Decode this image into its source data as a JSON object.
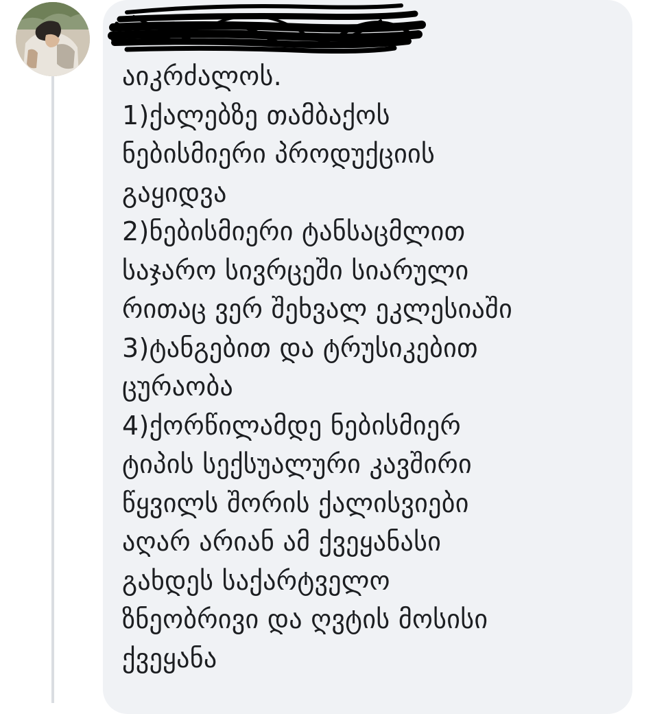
{
  "comment": {
    "author_name_redacted": true,
    "lines": [
      "აიკრძალოს.",
      "1)ქალებზე თამბაქოს",
      "ნებისმიერი პროდუქციის",
      "გაყიდვა",
      "2)ნებისმიერი ტანსაცმლით",
      "საჯარო სივრცეში სიარული",
      "რითაც ვერ შეხვალ ეკლესიაში",
      "3)ტანგებით და ტრუსიკებით",
      "ცურაობა",
      "4)ქორწილამდე ნებისმიერ",
      "ტიპის სექსუალური კავშირი",
      "წყვილს შორის ქალისვიები",
      "აღარ არიან ამ ქვეყანასი",
      "გახდეს საქარტველო",
      "ზნეობრივი და ღვტის მოსისი",
      "ქვეყანა"
    ]
  },
  "colors": {
    "bubble_background": "#f0f2f5",
    "text": "#1c1e21",
    "thread_line": "#dadde1",
    "redaction": "#000000"
  },
  "icons": {
    "avatar": "profile-photo",
    "redaction": "scribble-redaction"
  }
}
